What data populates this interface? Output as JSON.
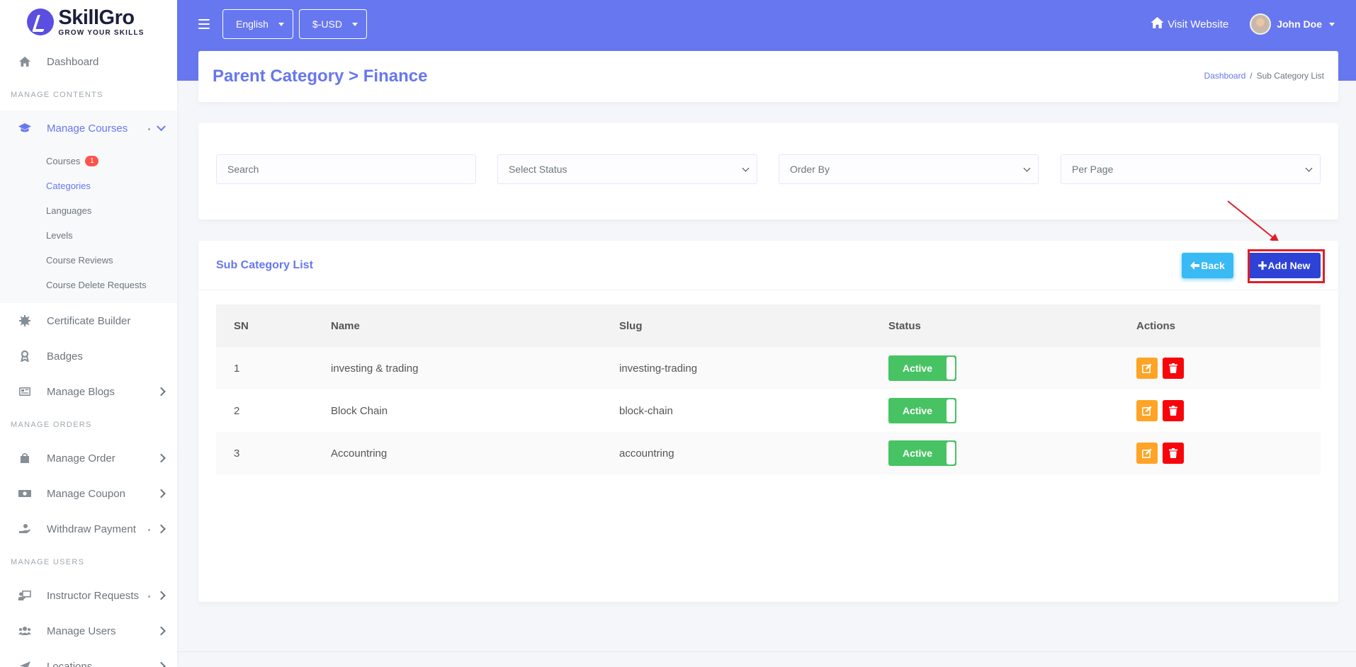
{
  "brand": {
    "name": "SkillGro",
    "tagline": "GROW YOUR SKILLS"
  },
  "topbar": {
    "language": "English",
    "currency": "$-USD",
    "visit_label": "Visit Website",
    "user_name": "John Doe"
  },
  "sidebar": {
    "dashboard": "Dashboard",
    "header_contents": "MANAGE CONTENTS",
    "manage_courses": "Manage Courses",
    "sub_items": [
      {
        "label": "Courses",
        "badge": "1"
      },
      {
        "label": "Categories"
      },
      {
        "label": "Languages"
      },
      {
        "label": "Levels"
      },
      {
        "label": "Course Reviews"
      },
      {
        "label": "Course Delete Requests"
      }
    ],
    "certificate_builder": "Certificate Builder",
    "badges": "Badges",
    "manage_blogs": "Manage Blogs",
    "header_orders": "MANAGE ORDERS",
    "manage_order": "Manage Order",
    "manage_coupon": "Manage Coupon",
    "withdraw_payment": "Withdraw Payment",
    "header_users": "MANAGE USERS",
    "instructor_requests": "Instructor Requests",
    "manage_users": "Manage Users",
    "locations": "Locations"
  },
  "page": {
    "title": "Parent Category > Finance",
    "breadcrumb_home": "Dashboard",
    "breadcrumb_sep": "/",
    "breadcrumb_current": "Sub Category List"
  },
  "filters": {
    "search_placeholder": "Search",
    "status": "Select Status",
    "order_by": "Order By",
    "per_page": "Per Page"
  },
  "list": {
    "title": "Sub Category List",
    "back_label": "Back",
    "add_label": "Add New",
    "columns": [
      "SN",
      "Name",
      "Slug",
      "Status",
      "Actions"
    ],
    "rows": [
      {
        "sn": "1",
        "name": "investing & trading",
        "slug": "investing-trading",
        "status": "Active"
      },
      {
        "sn": "2",
        "name": "Block Chain",
        "slug": "block-chain",
        "status": "Active"
      },
      {
        "sn": "3",
        "name": "Accountring",
        "slug": "accountring",
        "status": "Active"
      }
    ]
  },
  "colors": {
    "primary": "#6777ef",
    "success": "#47c363",
    "warning": "#ffa426",
    "danger": "#f7050b",
    "info": "#3abaf4",
    "highlight": "#e01e27"
  },
  "icons": {
    "dashboard": "home-icon",
    "courses": "graduation-cap-icon",
    "certificate": "certificate-icon",
    "badges": "award-icon",
    "blogs": "newspaper-icon",
    "order": "shopping-bag-icon",
    "coupon": "money-bill-icon",
    "withdraw": "hand-holding-usd-icon",
    "instructor": "chalkboard-teacher-icon",
    "users": "users-icon",
    "locations": "location-arrow-icon"
  }
}
